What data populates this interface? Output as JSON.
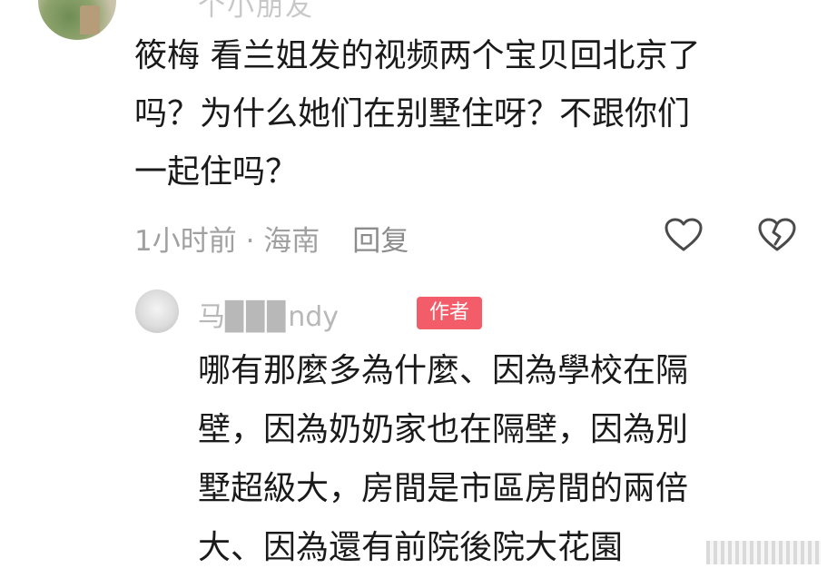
{
  "comment": {
    "username_fragment": "个小朋友",
    "text": "筱梅 看兰姐发的视频两个宝贝回北京了\n吗？为什么她们在别墅住呀？不跟你们\n一起住吗？",
    "time": "1小时前",
    "separator": " · ",
    "location": "海南",
    "reply_label": "回复",
    "icons": [
      "heart-icon",
      "broken-heart-icon"
    ]
  },
  "reply": {
    "username": "马▉▉▉ndy",
    "badge": "作者",
    "badge_color": "#f25d69",
    "text": "哪有那麼多為什麼、因為學校在隔\n壁，因為奶奶家也在隔壁，因為別\n墅超級大，房間是市區房間的兩倍\n大、因為還有前院後院大花園"
  }
}
